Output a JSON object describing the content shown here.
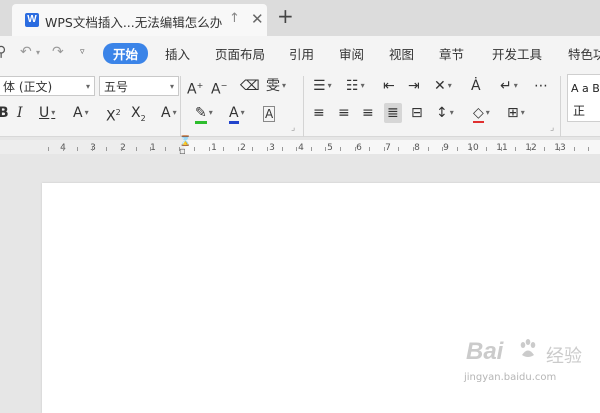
{
  "tab": {
    "app_letter": "W",
    "title": "WPS文档插入...无法编辑怎么办",
    "pin_icon": "↑",
    "close_icon": "✕",
    "new_tab_icon": "+"
  },
  "menu": {
    "items": [
      "开始",
      "插入",
      "页面布局",
      "引用",
      "审阅",
      "视图",
      "章节",
      "开发工具",
      "特色功"
    ]
  },
  "font": {
    "name": "体 (正文)",
    "size": "五号"
  },
  "styles": {
    "sample": "A a B",
    "label": "正"
  },
  "ruler": {
    "left_labels": [
      "4",
      "3",
      "2",
      "1"
    ],
    "right_labels": [
      "1",
      "2",
      "3",
      "4",
      "5",
      "6",
      "7",
      "8",
      "9",
      "10",
      "11",
      "12",
      "13"
    ]
  },
  "watermark": {
    "brand": "Bai",
    "brand2": "du",
    "cn": "经验",
    "url": "jingyan.baidu.com"
  },
  "colors": {
    "accent": "#3b84e8",
    "highlight_green": "#2dbd2d",
    "font_color_blue": "#2244cc",
    "font_color_red": "#e03030"
  }
}
